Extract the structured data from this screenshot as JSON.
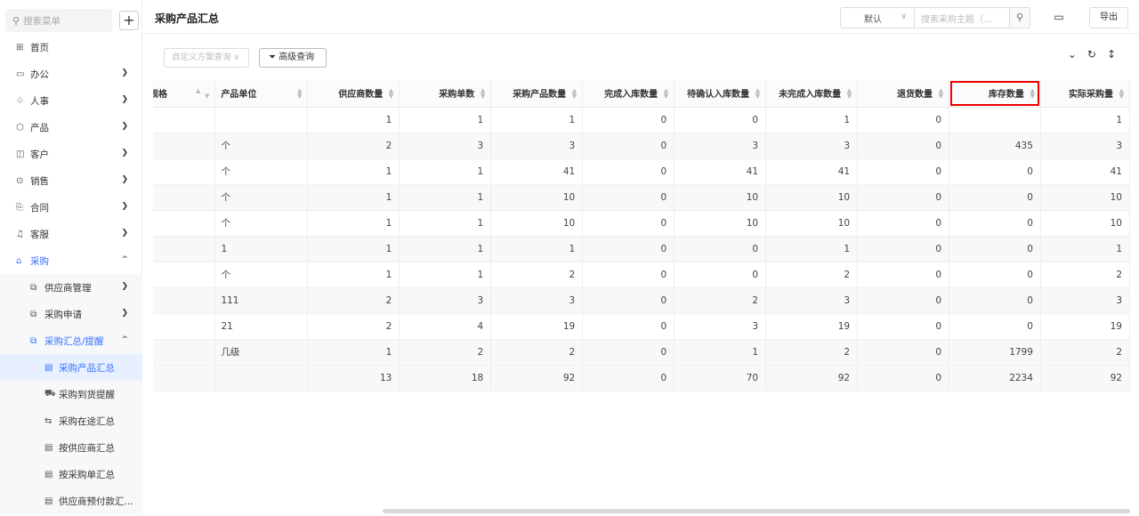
{
  "sidebar": {
    "search_placeholder": "搜索菜单",
    "add_label": "+",
    "items": [
      {
        "label": "首页",
        "icon": "home-icon",
        "glyph": "⊞"
      },
      {
        "label": "办公",
        "icon": "office-icon",
        "glyph": "▭"
      },
      {
        "label": "人事",
        "icon": "people-icon",
        "glyph": "♧"
      },
      {
        "label": "产品",
        "icon": "product-icon",
        "glyph": "⬡"
      },
      {
        "label": "客户",
        "icon": "customer-icon",
        "glyph": "◫"
      },
      {
        "label": "销售",
        "icon": "sales-icon",
        "glyph": "⊙"
      },
      {
        "label": "合同",
        "icon": "contract-icon",
        "glyph": "⎘"
      },
      {
        "label": "客服",
        "icon": "service-icon",
        "glyph": "♫"
      },
      {
        "label": "采购",
        "icon": "purchase-icon",
        "glyph": "⌂"
      }
    ],
    "purchase_sub": [
      {
        "label": "供应商管理"
      },
      {
        "label": "采购申请"
      },
      {
        "label": "采购汇总/提醒"
      }
    ],
    "summary_sub": [
      {
        "label": "采购产品汇总"
      },
      {
        "label": "采购到货提醒"
      },
      {
        "label": "采购在途汇总"
      },
      {
        "label": "按供应商汇总"
      },
      {
        "label": "按采购单汇总"
      },
      {
        "label": "供应商预付款汇..."
      }
    ]
  },
  "header": {
    "title": "采购产品汇总",
    "view_select": "默认",
    "topic_search_placeholder": "搜索采购主题（...",
    "export_label": "导出"
  },
  "toolbar": {
    "scheme_placeholder": "自定义方案查询",
    "advanced_label": "高级查询"
  },
  "table": {
    "headers": [
      "规格",
      "产品单位",
      "供应商数量",
      "采购单数",
      "采购产品数量",
      "完成入库数量",
      "待确认入库数量",
      "未完成入库数量",
      "退货数量",
      "库存数量",
      "实际采购量"
    ],
    "rows": [
      [
        "",
        "",
        "1",
        "1",
        "1",
        "0",
        "0",
        "1",
        "0",
        "",
        "1"
      ],
      [
        "",
        "个",
        "2",
        "3",
        "3",
        "0",
        "3",
        "3",
        "0",
        "435",
        "3"
      ],
      [
        "",
        "个",
        "1",
        "1",
        "41",
        "0",
        "41",
        "41",
        "0",
        "0",
        "41"
      ],
      [
        "",
        "个",
        "1",
        "1",
        "10",
        "0",
        "10",
        "10",
        "0",
        "0",
        "10"
      ],
      [
        "",
        "个",
        "1",
        "1",
        "10",
        "0",
        "10",
        "10",
        "0",
        "0",
        "10"
      ],
      [
        "",
        "1",
        "1",
        "1",
        "1",
        "0",
        "0",
        "1",
        "0",
        "0",
        "1"
      ],
      [
        "",
        "个",
        "1",
        "1",
        "2",
        "0",
        "0",
        "2",
        "0",
        "0",
        "2"
      ],
      [
        "",
        "111",
        "2",
        "3",
        "3",
        "0",
        "2",
        "3",
        "0",
        "0",
        "3"
      ],
      [
        "",
        "21",
        "2",
        "4",
        "19",
        "0",
        "3",
        "19",
        "0",
        "0",
        "19"
      ],
      [
        "",
        "几级",
        "1",
        "2",
        "2",
        "0",
        "1",
        "2",
        "0",
        "1799",
        "2"
      ]
    ],
    "total": [
      "",
      "",
      "13",
      "18",
      "92",
      "0",
      "70",
      "92",
      "0",
      "2234",
      "92"
    ]
  }
}
